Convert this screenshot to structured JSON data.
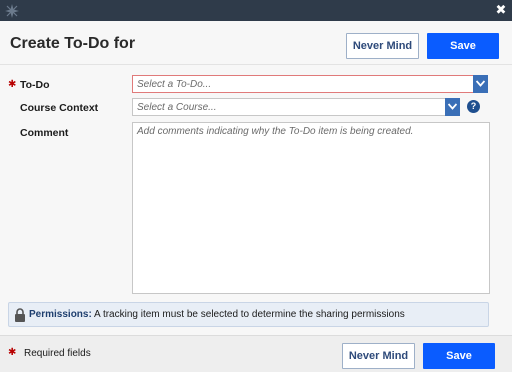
{
  "dialog": {
    "title": "Create To-Do for",
    "close_glyph": "✖",
    "logo_icon": "star-logo-icon"
  },
  "header": {
    "never_mind_label": "Never Mind",
    "save_label": "Save"
  },
  "form": {
    "required_marker": "✱",
    "todo": {
      "label": "To-Do",
      "required": true,
      "placeholder": "Select a To-Do..."
    },
    "course": {
      "label": "Course Context",
      "placeholder": "Select a Course...",
      "help_glyph": "?"
    },
    "comment": {
      "label": "Comment",
      "placeholder": "Add comments indicating why the To-Do item is being created."
    }
  },
  "permissions": {
    "heading": "Permissions:",
    "message": "A tracking item must be selected to determine the sharing permissions"
  },
  "footer": {
    "required_note": "Required fields",
    "never_mind_label": "Never Mind",
    "save_label": "Save"
  },
  "colors": {
    "titlebar": "#2f3b4a",
    "primary": "#0a5cff",
    "required": "#b80000",
    "dropdown_arrow": "#3a6fb7"
  }
}
